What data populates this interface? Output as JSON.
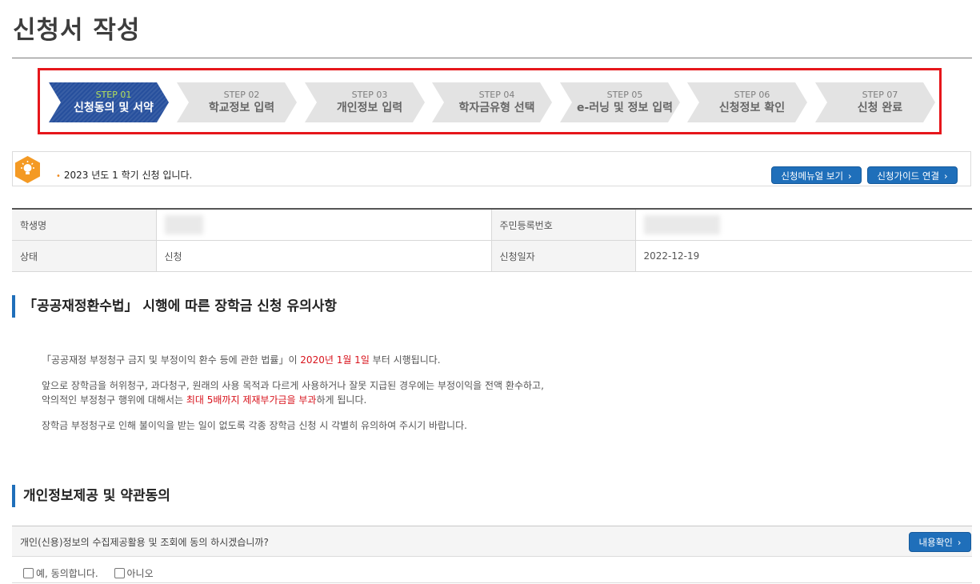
{
  "page_title": "신청서 작성",
  "steps": [
    {
      "num": "STEP 01",
      "label": "신청동의 및 서약",
      "active": true
    },
    {
      "num": "STEP 02",
      "label": "학교정보 입력"
    },
    {
      "num": "STEP 03",
      "label": "개인정보 입력"
    },
    {
      "num": "STEP 04",
      "label": "학자금유형 선택"
    },
    {
      "num": "STEP 05",
      "label": "e-러닝 및 정보 입력"
    },
    {
      "num": "STEP 06",
      "label": "신청정보 확인"
    },
    {
      "num": "STEP 07",
      "label": "신청 완료"
    }
  ],
  "notice": {
    "text": "2023 년도 1 학기 신청 입니다.",
    "icon": "lightbulb-icon",
    "manual_button": "신청메뉴얼 보기",
    "guide_button": "신청가이드 연결"
  },
  "info": {
    "student_name_label": "학생명",
    "student_name_value": "",
    "rrn_label": "주민등록번호",
    "rrn_value": "",
    "status_label": "상태",
    "status_value": "신청",
    "date_label": "신청일자",
    "date_value": "2022-12-19"
  },
  "section1": {
    "title": "「공공재정환수법」 시행에 따른 장학금 신청 유의사항",
    "p1_a": "「공공재정 부정청구 금지 및 부정이익 환수 등에 관한 법률」이 ",
    "p1_red": "2020년 1월 1일",
    "p1_b": " 부터 시행됩니다.",
    "p2_line1": "앞으로 장학금을 허위청구, 과다청구, 원래의 사용 목적과 다르게 사용하거나 잘못 지급된 경우에는 부정이익을 전액 환수하고,",
    "p2_line2_a": "악의적인 부정청구 행위에 대해서는 ",
    "p2_line2_red": "최대 5배까지 제재부가금을 부과",
    "p2_line2_b": "하게 됩니다.",
    "p3": "장학금 부정청구로 인해 불이익을 받는 일이 없도록 각종 장학금 신청 시 각별히 유의하여 주시기 바랍니다."
  },
  "section2": {
    "title": "개인정보제공 및 약관동의",
    "question": "개인(신용)정보의 수집제공활용 및 조회에 동의 하시겠습니까?",
    "confirm_button": "내용확인",
    "option_yes": "예, 동의합니다.",
    "option_no": "아니오"
  },
  "colors": {
    "accent_blue": "#1f6fba",
    "step_active": "#27509d",
    "highlight_red": "#d8131c",
    "notice_icon": "#f49a24"
  }
}
